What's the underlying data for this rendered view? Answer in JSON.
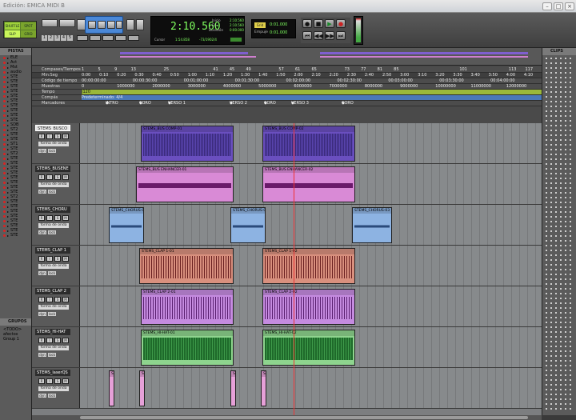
{
  "window": {
    "title": "Edición: EMICA MIDI B"
  },
  "transport": {
    "main_counter": "2:10.560",
    "counter_labels": {
      "start": "Inicio",
      "end": "Fin",
      "length": "Duración"
    },
    "counter_values": {
      "start": "2:10.560",
      "end": "2:10.560",
      "length": "0:00.000"
    },
    "cursor_label": "Cursor",
    "cursor_value": "1:54.858",
    "sample_value": "-73/1902/4",
    "grid_label": "Grid",
    "grid_value": "0:01.000",
    "nudge_label": "Empuje",
    "nudge_value": "0:01.000",
    "mode_left": "SHUFFLE",
    "mode_right": "SPOT",
    "mode_left2": "SLIP",
    "mode_right2": "GRID",
    "numbers": [
      "1",
      "2",
      "3",
      "4",
      "5"
    ]
  },
  "panels": {
    "tracks": "PISTAS",
    "groups": "GRUPOS",
    "clips": "CLIPS"
  },
  "ruler_labels": [
    "Compases/Tiempos",
    "Min:Seg",
    "Código de tiempo",
    "Muestras",
    "Tempo",
    "Compás",
    "Marcadores"
  ],
  "ruler_bars": [
    "1",
    "5",
    "9",
    "13",
    "",
    "25",
    "",
    "",
    "41",
    "45",
    "49",
    "",
    "57",
    "61",
    "65",
    "",
    "73",
    "77",
    "81",
    "85",
    "",
    "",
    "",
    "101",
    "",
    "",
    "113",
    "117"
  ],
  "ruler_minsec": [
    "0:00",
    "0:10",
    "0:20",
    "0:30",
    "0:40",
    "0:50",
    "1:00",
    "1:10",
    "1:20",
    "1:30",
    "1:40",
    "1:50",
    "2:00",
    "2:10",
    "2:20",
    "2:30",
    "2:40",
    "2:50",
    "3:00",
    "3:10",
    "3:20",
    "3:30",
    "3:40",
    "3:50",
    "4:00",
    "4:10"
  ],
  "ruler_timecode": [
    "00:00:00:00",
    "00:00:30:00",
    "00:01:00:00",
    "00:01:30:00",
    "00:02:00:00",
    "00:02:30:00",
    "00:03:00:00",
    "00:03:30:00",
    "00:04:00:00"
  ],
  "ruler_samples": [
    "0",
    "1000000",
    "2000000",
    "3000000",
    "4000000",
    "5000000",
    "6000000",
    "7000000",
    "8000000",
    "9000000",
    "10000000",
    "11000000",
    "12000000"
  ],
  "tempo_value": "J120",
  "meter_value": "Predeterminado: 4/4",
  "markers": [
    "INTRO",
    "CORO",
    "VERSO 1",
    "VERSO 2",
    "CORO",
    "VERSO 3",
    "CORO"
  ],
  "track_list": [
    "ELE",
    "Act",
    "Mst",
    "audio",
    "STE",
    "STE",
    "STE",
    "STE",
    "STE",
    "STE",
    "STE",
    "STE",
    "STE",
    "STE",
    "SDB",
    "ST2",
    "STE",
    "STE",
    "ST1",
    "STE",
    "ST2",
    "STE",
    "STE",
    "STE",
    "STE",
    "STE",
    "STE",
    "STE",
    "STE",
    "ST2",
    "STE",
    "STE",
    "STE",
    "STE",
    "STE",
    "STE",
    "STE",
    "STE"
  ],
  "group_list": [
    "<TODO>",
    "afectox",
    "Group 1"
  ],
  "track_labels": {
    "view": "forma de onda",
    "s": "S",
    "m": "M",
    "r": "R",
    "i": "I",
    "dyn": "dyn",
    "lock": "lock"
  },
  "tracks": [
    {
      "name": "STEMS_BUSCO",
      "clips": [
        "STEMS_BUS COMP-01",
        "STEMS_BUS COMP-02"
      ]
    },
    {
      "name": "STEMS_BUSENE",
      "clips": [
        "STEMS_BUS ENHANCER-01",
        "STEMS_BUS ENHANCER-02"
      ]
    },
    {
      "name": "STEMS_CHORU",
      "clips": [
        "STEMS_CHORUS-01",
        "STEMS_CHORUS-02",
        "STEMS_CHORUS-03"
      ]
    },
    {
      "name": "STEMS_CLAP 1",
      "clips": [
        "STEMS_CLAP 1-01",
        "STEMS_CLAP 1-02"
      ]
    },
    {
      "name": "STEMS_CLAP 2",
      "clips": [
        "STEMS_CLAP 2-01",
        "STEMS_CLAP 2-02"
      ]
    },
    {
      "name": "STEMS_HI-HAT",
      "clips": [
        "STEMS_HI-HAT-01",
        "STEMS_HI-HAT-02"
      ]
    },
    {
      "name": "STEMS_laserQS",
      "clips": [
        "ST",
        "ST",
        "ST",
        "ST"
      ]
    }
  ],
  "colors": {
    "bus": "#6a4fbf",
    "enh": "#d98ad6",
    "chorus": "#8db3e2",
    "clap1": "#d9907e",
    "clap2": "#c58be0",
    "hihat": "#8ed48e",
    "laser": "#e6a0d8",
    "accent": "#7fff5f"
  }
}
